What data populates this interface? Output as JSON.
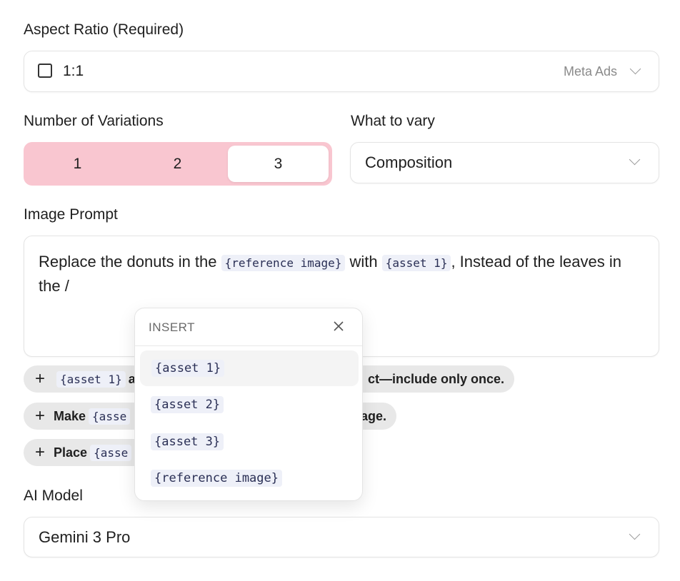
{
  "aspect": {
    "label": "Aspect Ratio (Required)",
    "value": "1:1",
    "hint": "Meta Ads"
  },
  "variations": {
    "label": "Number of Variations",
    "options": [
      "1",
      "2",
      "3"
    ],
    "selected": "3"
  },
  "vary": {
    "label": "What to vary",
    "value": "Composition"
  },
  "prompt": {
    "label": "Image Prompt",
    "part1": "Replace the donuts in the ",
    "token1": "{reference image}",
    "part2": " with ",
    "token2": "{asset 1}",
    "part3": ", Instead of the leaves in the /"
  },
  "chips": [
    {
      "prefix": "",
      "token": "{asset 1}",
      "visible_start": "a",
      "visible_end": "ct—include only once."
    },
    {
      "prefix": "Make",
      "token": "{asse",
      "visible_end": "age."
    },
    {
      "prefix": "Place",
      "token": "{asse"
    }
  ],
  "model": {
    "label": "AI Model",
    "value": "Gemini 3 Pro"
  },
  "insert_popup": {
    "title": "INSERT",
    "items": [
      "{asset 1}",
      "{asset 2}",
      "{asset 3}",
      "{reference image}"
    ]
  },
  "colors": {
    "segment_bg": "#f9c6d0",
    "token_bg": "#eef0f8",
    "chip_bg": "#e8e8e8"
  }
}
